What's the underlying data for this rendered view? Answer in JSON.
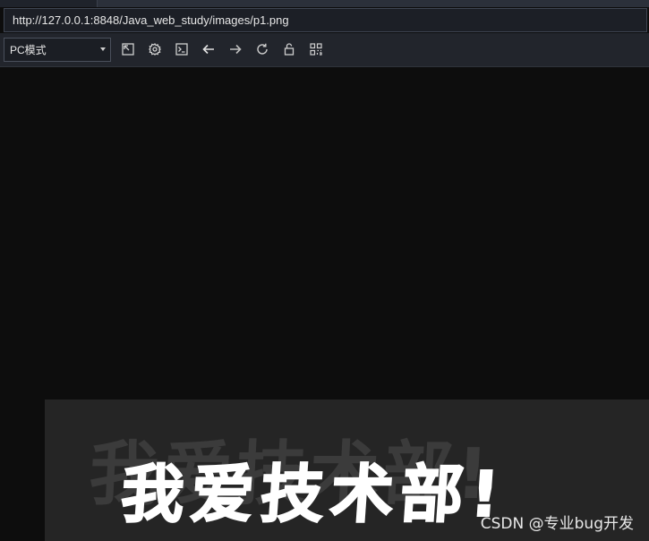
{
  "address_bar": {
    "url": "http://127.0.0.1:8848/Java_web_study/images/p1.png"
  },
  "toolbar": {
    "mode_select": "PC模式",
    "buttons": [
      {
        "icon": "expand-icon"
      },
      {
        "icon": "gear-icon"
      },
      {
        "icon": "terminal-icon"
      },
      {
        "icon": "arrow-left-icon"
      },
      {
        "icon": "arrow-right-icon"
      },
      {
        "icon": "refresh-icon"
      },
      {
        "icon": "unlock-icon"
      },
      {
        "icon": "qr-code-icon"
      }
    ]
  },
  "image": {
    "shadow_text": "我爱技术部!",
    "banner_text": "我爱技术部!",
    "watermark": "CSDN @专业bug开发"
  },
  "colors": {
    "background": "#0d0d0d",
    "toolbar": "#22252c",
    "image_background": "#252525",
    "banner_text": "#ffffff"
  }
}
